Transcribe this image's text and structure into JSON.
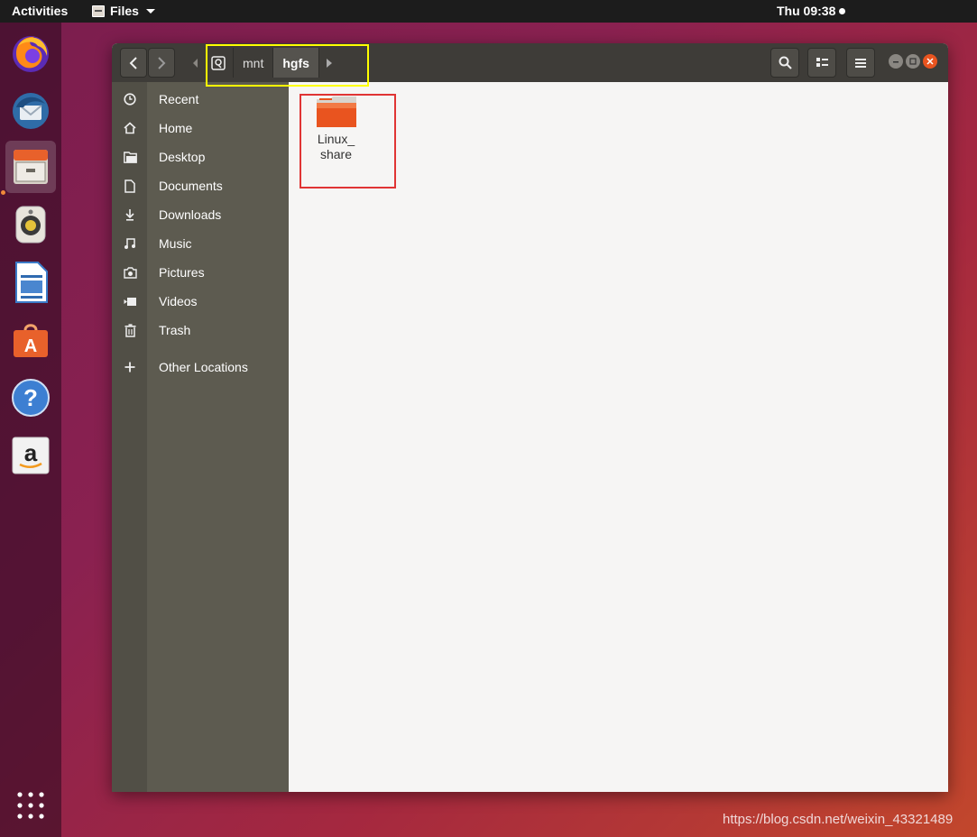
{
  "topbar": {
    "activities": "Activities",
    "app_menu": "Files",
    "clock": "Thu 09:38"
  },
  "dock": {
    "items": [
      {
        "name": "firefox"
      },
      {
        "name": "thunderbird"
      },
      {
        "name": "files"
      },
      {
        "name": "rhythmbox"
      },
      {
        "name": "libreoffice-writer"
      },
      {
        "name": "software-center"
      },
      {
        "name": "help"
      },
      {
        "name": "amazon"
      }
    ]
  },
  "window": {
    "pathbar": {
      "crumbs": [
        "mnt",
        "hgfs"
      ]
    },
    "sidebar": {
      "items": [
        {
          "label": "Recent",
          "icon": "clock-icon"
        },
        {
          "label": "Home",
          "icon": "home-icon"
        },
        {
          "label": "Desktop",
          "icon": "folder-icon"
        },
        {
          "label": "Documents",
          "icon": "document-icon"
        },
        {
          "label": "Downloads",
          "icon": "download-icon"
        },
        {
          "label": "Music",
          "icon": "music-icon"
        },
        {
          "label": "Pictures",
          "icon": "camera-icon"
        },
        {
          "label": "Videos",
          "icon": "video-icon"
        },
        {
          "label": "Trash",
          "icon": "trash-icon"
        }
      ],
      "other_locations": "Other Locations"
    },
    "content": {
      "items": [
        {
          "name": "Linux_\nshare",
          "name_line1": "Linux_",
          "name_line2": "share",
          "type": "folder"
        }
      ]
    }
  },
  "watermark": "https://blog.csdn.net/weixin_43321489",
  "colors": {
    "folder": "#e9541f",
    "accent": "#e95420",
    "highlight_yellow": "#ffff00",
    "highlight_red": "#e03434"
  }
}
